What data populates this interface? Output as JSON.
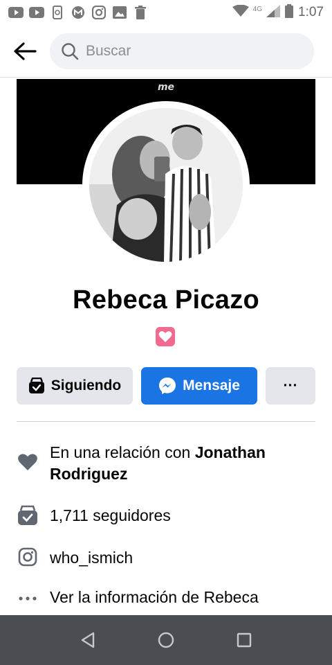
{
  "status_bar": {
    "time": "1:07",
    "network": "4G",
    "left_icons": [
      "youtube-icon",
      "youtube-icon",
      "phone-data-icon",
      "gmail-icon",
      "instagram-icon",
      "image-icon",
      "trash-icon"
    ]
  },
  "header": {
    "search_placeholder": "Buscar"
  },
  "cover": {
    "text": "me"
  },
  "profile": {
    "name": "Rebeca Picazo",
    "badge_icon": "heart-badge-icon"
  },
  "buttons": {
    "following_label": "Siguiendo",
    "message_label": "Mensaje",
    "more_label": "···"
  },
  "info": {
    "relationship_prefix": "En una relación con ",
    "relationship_name": "Jonathan Rodriguez",
    "followers": "1,711 seguidores",
    "instagram": "who_ismich",
    "see_info": "Ver la información de Rebeca"
  },
  "colors": {
    "accent": "#1b74e4",
    "button_gray": "#e4e6eb",
    "badge_pink": "#f06b8f",
    "nav_bar": "#4a4d52"
  }
}
